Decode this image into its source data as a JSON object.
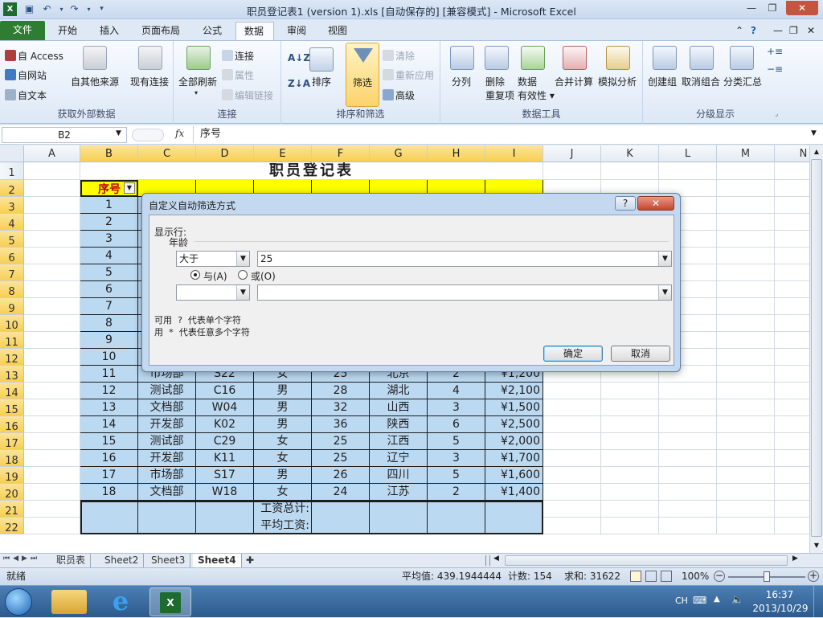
{
  "window": {
    "title": "职员登记表1 (version 1).xls [自动保存的]  [兼容模式] - Microsoft Excel"
  },
  "tabs": [
    "文件",
    "开始",
    "插入",
    "页面布局",
    "公式",
    "数据",
    "审阅",
    "视图"
  ],
  "ribbon": {
    "get_external": {
      "label": "获取外部数据",
      "access": "自 Access",
      "web": "自网站",
      "text": "自文本",
      "other": "自其他来源",
      "existing": "现有连接"
    },
    "connections": {
      "label": "连接",
      "refresh_all": "全部刷新",
      "connections": "连接",
      "properties": "属性",
      "edit_links": "编辑链接"
    },
    "sort_filter": {
      "label": "排序和筛选",
      "sort": "排序",
      "filter": "筛选",
      "clear": "清除",
      "reapply": "重新应用",
      "advanced": "高级"
    },
    "data_tools": {
      "label": "数据工具",
      "split": "分列",
      "remove_dup_1": "删除",
      "remove_dup_2": "重复项",
      "validation_1": "数据",
      "validation_2": "有效性",
      "consolidate": "合并计算",
      "whatif": "模拟分析"
    },
    "outline": {
      "label": "分级显示",
      "group": "创建组",
      "ungroup": "取消组合",
      "subtotal": "分类汇总"
    }
  },
  "formula_bar": {
    "name_box": "B2",
    "fx": "fx",
    "content": "序号"
  },
  "columns": [
    "A",
    "B",
    "C",
    "D",
    "E",
    "F",
    "G",
    "H",
    "I",
    "J",
    "K",
    "L",
    "M",
    "N"
  ],
  "sheet": {
    "title": "职员登记表",
    "header_first": "序号",
    "rows": [
      {
        "r": "3",
        "n": "1"
      },
      {
        "r": "4",
        "n": "2"
      },
      {
        "r": "5",
        "n": "3"
      },
      {
        "r": "6",
        "n": "4"
      },
      {
        "r": "7",
        "n": "5"
      },
      {
        "r": "8",
        "n": "6"
      },
      {
        "r": "9",
        "n": "7"
      },
      {
        "r": "10",
        "n": "8"
      },
      {
        "r": "11",
        "n": "9"
      },
      {
        "r": "12",
        "n": "10"
      }
    ],
    "data_rows": [
      {
        "r": "13",
        "n": "11",
        "dept": "市场部",
        "id": "S22",
        "sex": "女",
        "age": "25",
        "place": "北京",
        "years": "2",
        "salary": "¥1,200"
      },
      {
        "r": "14",
        "n": "12",
        "dept": "测试部",
        "id": "C16",
        "sex": "男",
        "age": "28",
        "place": "湖北",
        "years": "4",
        "salary": "¥2,100"
      },
      {
        "r": "15",
        "n": "13",
        "dept": "文档部",
        "id": "W04",
        "sex": "男",
        "age": "32",
        "place": "山西",
        "years": "3",
        "salary": "¥1,500"
      },
      {
        "r": "16",
        "n": "14",
        "dept": "开发部",
        "id": "K02",
        "sex": "男",
        "age": "36",
        "place": "陕西",
        "years": "6",
        "salary": "¥2,500"
      },
      {
        "r": "17",
        "n": "15",
        "dept": "测试部",
        "id": "C29",
        "sex": "女",
        "age": "25",
        "place": "江西",
        "years": "5",
        "salary": "¥2,000"
      },
      {
        "r": "18",
        "n": "16",
        "dept": "开发部",
        "id": "K11",
        "sex": "女",
        "age": "25",
        "place": "辽宁",
        "years": "3",
        "salary": "¥1,700"
      },
      {
        "r": "19",
        "n": "17",
        "dept": "市场部",
        "id": "S17",
        "sex": "男",
        "age": "26",
        "place": "四川",
        "years": "5",
        "salary": "¥1,600"
      },
      {
        "r": "20",
        "n": "18",
        "dept": "文档部",
        "id": "W18",
        "sex": "女",
        "age": "24",
        "place": "江苏",
        "years": "2",
        "salary": "¥1,400"
      }
    ],
    "total_label": "工资总计:",
    "avg_label": "平均工资:",
    "row_numbers": [
      "1",
      "2",
      "21",
      "22"
    ]
  },
  "sheet_tabs": [
    "职员表",
    "Sheet2",
    "Sheet3",
    "Sheet4"
  ],
  "status": {
    "mode": "就绪",
    "average": "平均值: 439.1944444",
    "count": "计数: 154",
    "sum": "求和: 31622",
    "zoom": "100%"
  },
  "taskbar": {
    "lang": "CH",
    "time": "16:37",
    "date": "2013/10/29"
  },
  "dialog": {
    "title": "自定义自动筛选方式",
    "show_rows": "显示行:",
    "field": "年龄",
    "op1": "大于",
    "val1": "25",
    "and_label": "与(A)",
    "or_label": "或(O)",
    "op2": "",
    "val2": "",
    "hint1": "可用 ? 代表单个字符",
    "hint2": "用 * 代表任意多个字符",
    "ok": "确定",
    "cancel": "取消",
    "help": "?"
  },
  "colors": {
    "table_fill": "#bcd9f2",
    "header_fill": "#ffff00",
    "header_text": "#c00000",
    "file_tab": "#2e7d32"
  }
}
